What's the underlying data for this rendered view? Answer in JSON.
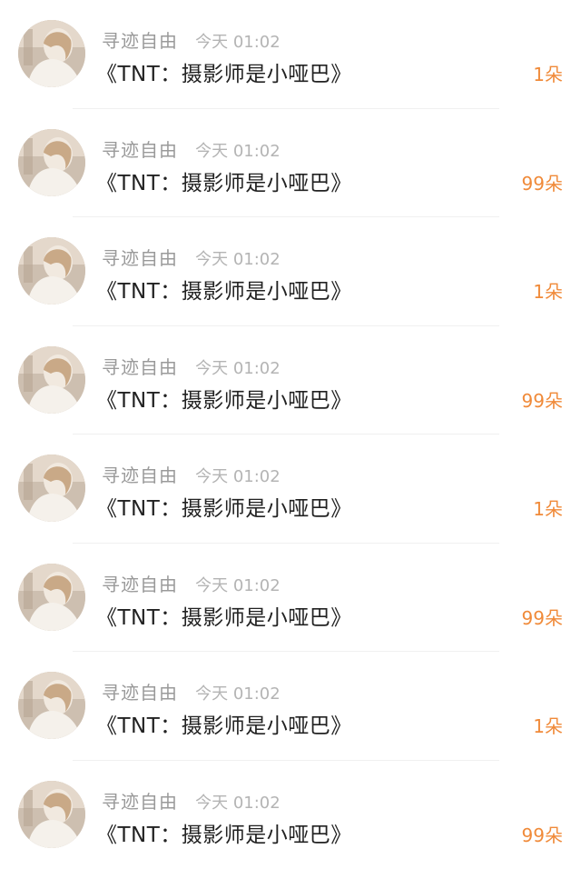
{
  "colors": {
    "username": "#9a9a9a",
    "time": "#b4b4b4",
    "title": "#222222",
    "gift_count": "#f08a39",
    "divider": "#f0f0f0"
  },
  "items": [
    {
      "username": "寻迹自由",
      "time": "今天 01:02",
      "title": "《TNT：摄影师是小哑巴》",
      "gift_count": "1朵",
      "avatar_icon": "user-avatar"
    },
    {
      "username": "寻迹自由",
      "time": "今天 01:02",
      "title": "《TNT：摄影师是小哑巴》",
      "gift_count": "99朵",
      "avatar_icon": "user-avatar"
    },
    {
      "username": "寻迹自由",
      "time": "今天 01:02",
      "title": "《TNT：摄影师是小哑巴》",
      "gift_count": "1朵",
      "avatar_icon": "user-avatar"
    },
    {
      "username": "寻迹自由",
      "time": "今天 01:02",
      "title": "《TNT：摄影师是小哑巴》",
      "gift_count": "99朵",
      "avatar_icon": "user-avatar"
    },
    {
      "username": "寻迹自由",
      "time": "今天 01:02",
      "title": "《TNT：摄影师是小哑巴》",
      "gift_count": "1朵",
      "avatar_icon": "user-avatar"
    },
    {
      "username": "寻迹自由",
      "time": "今天 01:02",
      "title": "《TNT：摄影师是小哑巴》",
      "gift_count": "99朵",
      "avatar_icon": "user-avatar"
    },
    {
      "username": "寻迹自由",
      "time": "今天 01:02",
      "title": "《TNT：摄影师是小哑巴》",
      "gift_count": "1朵",
      "avatar_icon": "user-avatar"
    },
    {
      "username": "寻迹自由",
      "time": "今天 01:02",
      "title": "《TNT：摄影师是小哑巴》",
      "gift_count": "99朵",
      "avatar_icon": "user-avatar"
    }
  ]
}
